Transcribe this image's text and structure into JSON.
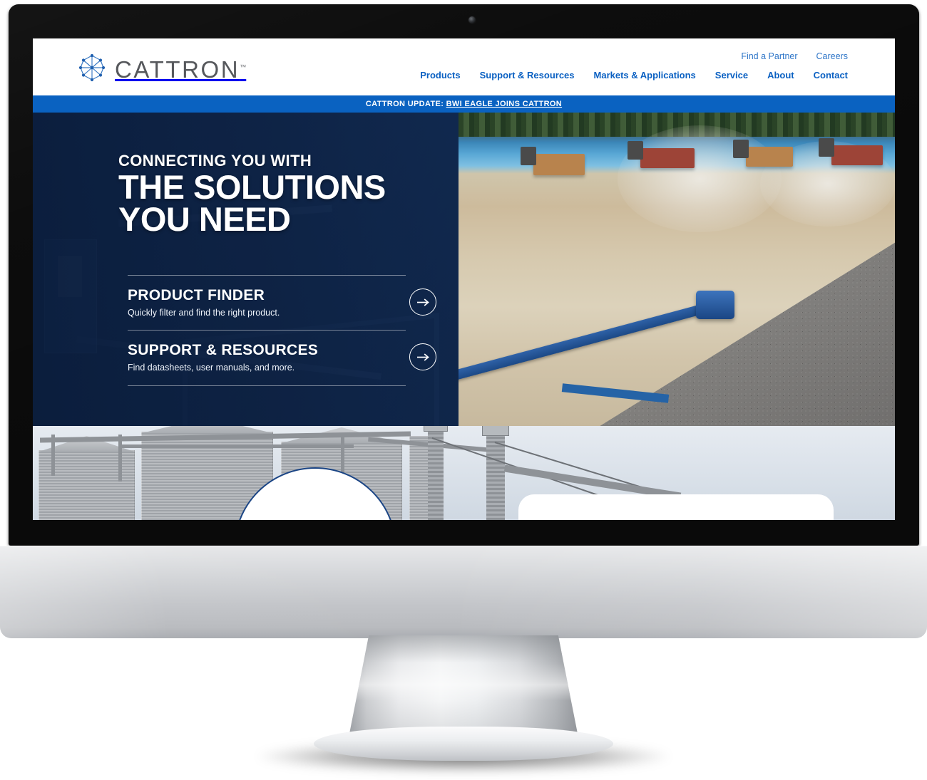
{
  "brand": {
    "name": "CATTRON",
    "trademark": "™",
    "logo_icon": "cattron-network-hex-icon",
    "logo_color": "#2f6fc0",
    "wordmark_color": "#56585c"
  },
  "colors": {
    "nav_blue": "#0a60c2",
    "utility_blue": "#2f76c8",
    "announcement_blue": "#0a62c1",
    "hero_navy": "#15315c",
    "accent_outline": "#1b4585"
  },
  "header": {
    "utility_links": [
      {
        "label": "Find a Partner"
      },
      {
        "label": "Careers"
      }
    ],
    "main_nav": [
      {
        "label": "Products"
      },
      {
        "label": "Support & Resources"
      },
      {
        "label": "Markets & Applications"
      },
      {
        "label": "Service"
      },
      {
        "label": "About"
      },
      {
        "label": "Contact"
      }
    ]
  },
  "announcement": {
    "prefix": "CATTRON UPDATE: ",
    "link_label": "BWI EAGLE JOINS CATTRON"
  },
  "hero": {
    "eyebrow": "CONNECTING YOU WITH",
    "title_line_1": "THE SOLUTIONS",
    "title_line_2": "YOU NEED",
    "ctas": [
      {
        "title": "PRODUCT FINDER",
        "subtitle": "Quickly filter and find the right product.",
        "arrow_icon": "arrow-right-circle-icon"
      },
      {
        "title": "SUPPORT & RESOURCES",
        "subtitle": "Find datasheets, user manuals, and more.",
        "arrow_icon": "arrow-right-circle-icon"
      }
    ],
    "left_image_alt": "industrial-plant-duotone",
    "right_image_alt": "quarry-with-dump-trucks"
  },
  "lower_section": {
    "image_alt": "grain-silos-and-conveyor-tower"
  },
  "device": {
    "type": "imac-desktop-monitor",
    "webcam_icon": "webcam-dot-icon"
  }
}
